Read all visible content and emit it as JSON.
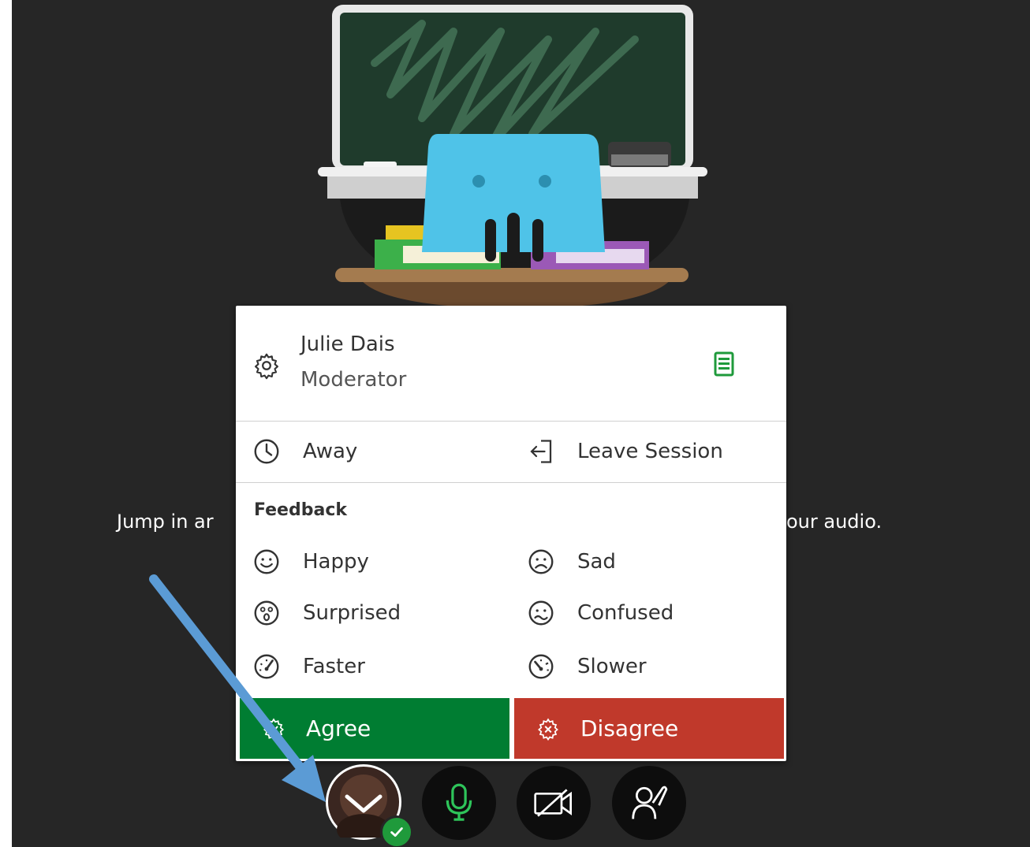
{
  "background": {
    "prompt_left": "Jump in ar",
    "prompt_right": "our audio."
  },
  "user": {
    "name": "Julie Dais",
    "role": "Moderator"
  },
  "status_items": [
    {
      "label": "Away",
      "icon": "clock-icon"
    },
    {
      "label": "Leave Session",
      "icon": "leave-icon"
    }
  ],
  "feedback": {
    "title": "Feedback",
    "items": [
      {
        "label": "Happy",
        "icon": "happy-face-icon"
      },
      {
        "label": "Sad",
        "icon": "sad-face-icon"
      },
      {
        "label": "Surprised",
        "icon": "surprised-face-icon"
      },
      {
        "label": "Confused",
        "icon": "confused-face-icon"
      },
      {
        "label": "Faster",
        "icon": "speed-fast-icon"
      },
      {
        "label": "Slower",
        "icon": "speed-slow-icon"
      }
    ],
    "agree_label": "Agree",
    "disagree_label": "Disagree"
  },
  "colors": {
    "agree": "#007d32",
    "disagree": "#c0392b",
    "mic_green": "#2ec45a",
    "status_green": "#1f9a3b",
    "annotation_arrow": "#5b9bd5"
  },
  "controls": [
    {
      "name": "avatar-button",
      "icon": "avatar-chevron-icon"
    },
    {
      "name": "mic-button",
      "icon": "microphone-icon"
    },
    {
      "name": "camera-button",
      "icon": "camera-off-icon"
    },
    {
      "name": "share-button",
      "icon": "raise-hand-icon"
    }
  ]
}
